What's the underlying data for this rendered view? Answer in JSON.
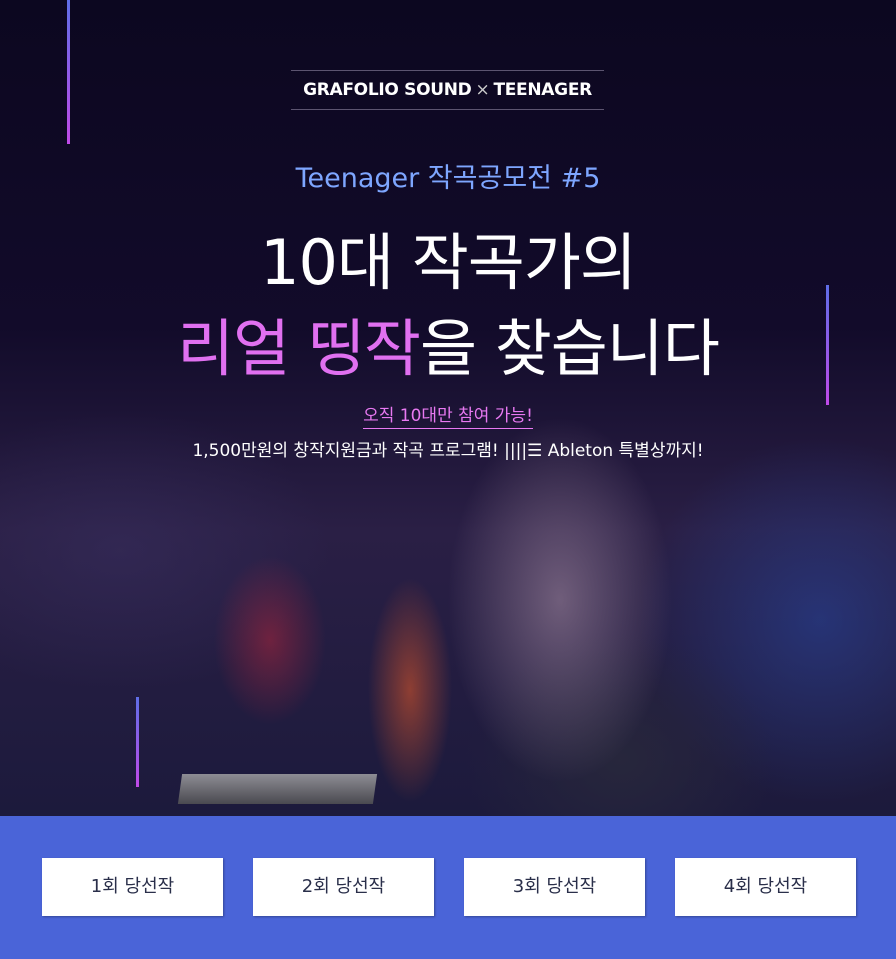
{
  "brand": {
    "left": "GRAFOLIO SOUND",
    "separator": "×",
    "right": "TEENAGER"
  },
  "subtitle": "Teenager 작곡공모전 #5",
  "headline": {
    "line1": "10대 작곡가의",
    "line2_highlight": "리얼 띵작",
    "line2_rest": "을 찾습니다"
  },
  "eligibility": "오직 10대만 참여 가능!",
  "description": "1,500만원의 창작지원금과  작곡 프로그램! ||||☰ Ableton 특별상까지!",
  "colors": {
    "accent_pink": "#e879f2",
    "accent_blue": "#7ea6ff",
    "footer_bg": "#4a64d8"
  },
  "winners": [
    {
      "label": "1회 당선작"
    },
    {
      "label": "2회 당선작"
    },
    {
      "label": "3회 당선작"
    },
    {
      "label": "4회 당선작"
    }
  ]
}
